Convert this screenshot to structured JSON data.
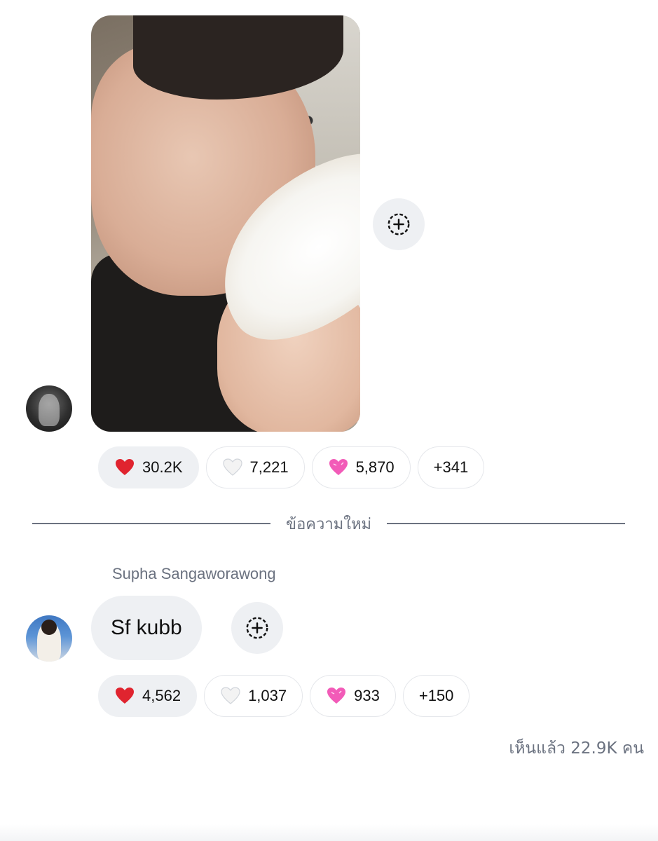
{
  "messages": [
    {
      "type": "photo",
      "photo_alt": "",
      "reactions": [
        {
          "emoji": "red-heart-icon",
          "count": "30.2K",
          "active": true
        },
        {
          "emoji": "white-heart-icon",
          "count": "7,221",
          "active": false
        },
        {
          "emoji": "pink-heart-icon",
          "count": "5,870",
          "active": false
        },
        {
          "emoji": "",
          "count": "+341",
          "active": false
        }
      ]
    },
    {
      "type": "text",
      "sender": "Supha Sangaworawong",
      "text": "Sf kubb",
      "reactions": [
        {
          "emoji": "red-heart-icon",
          "count": "4,562",
          "active": true
        },
        {
          "emoji": "white-heart-icon",
          "count": "1,037",
          "active": false
        },
        {
          "emoji": "pink-heart-icon",
          "count": "933",
          "active": false
        },
        {
          "emoji": "",
          "count": "+150",
          "active": false
        }
      ]
    }
  ],
  "divider": {
    "label": "ข้อความใหม่"
  },
  "seen_by": "เห็นแล้ว 22.9K คน",
  "colors": {
    "bubble_bg": "#eef0f3",
    "muted_text": "#6b7280",
    "pill_border": "#e5e7eb"
  }
}
